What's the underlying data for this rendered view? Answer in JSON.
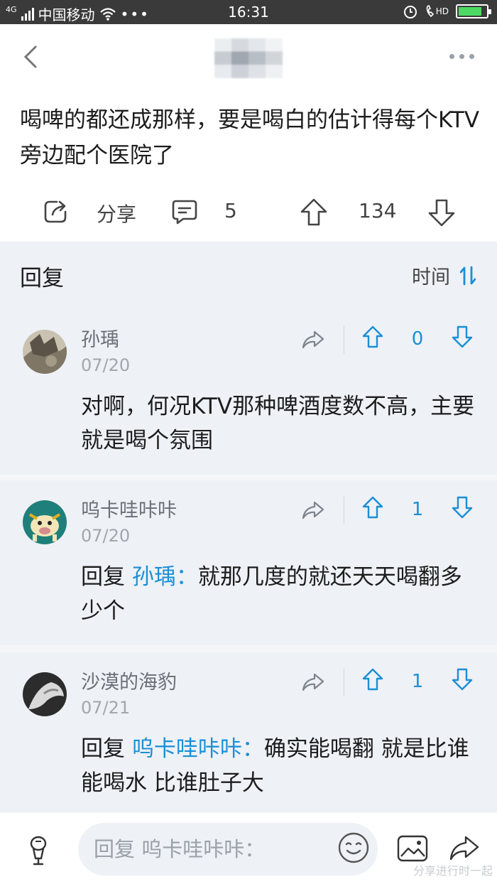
{
  "status_bar": {
    "network": "4G",
    "carrier": "中国移动",
    "time": "16:31",
    "hd_label": "HD",
    "battery_level": 0.85
  },
  "post": {
    "text": "喝啤的都还成那样，要是喝白的估计得每个KTV旁边配个医院了",
    "share_label": "分享",
    "comment_count": "5",
    "vote_count": "134"
  },
  "replies": {
    "title": "回复",
    "sort_label": "时间"
  },
  "comments": [
    {
      "username": "孙瑀",
      "date": "07/20",
      "reply_prefix": "",
      "mention": "",
      "text": "对啊，何况KTV那种啤酒度数不高，主要就是喝个氛围",
      "votes": "0"
    },
    {
      "username": "呜卡哇咔咔",
      "date": "07/20",
      "reply_prefix": "回复 ",
      "mention": "孙瑀：",
      "text": "就那几度的就还天天喝翻多少个",
      "votes": "1"
    },
    {
      "username": "沙漠的海豹",
      "date": "07/21",
      "reply_prefix": "回复 ",
      "mention": "呜卡哇咔咔：",
      "text": "确实能喝翻 就是比谁能喝水 比谁肚子大",
      "votes": "1"
    }
  ],
  "composer": {
    "placeholder": "回复 呜卡哇咔咔："
  },
  "watermark": "分享进行时一起",
  "colors": {
    "accent": "#1a8fd6",
    "page_bg": "#eef1f6",
    "status_bar": "#3a3a3a"
  }
}
